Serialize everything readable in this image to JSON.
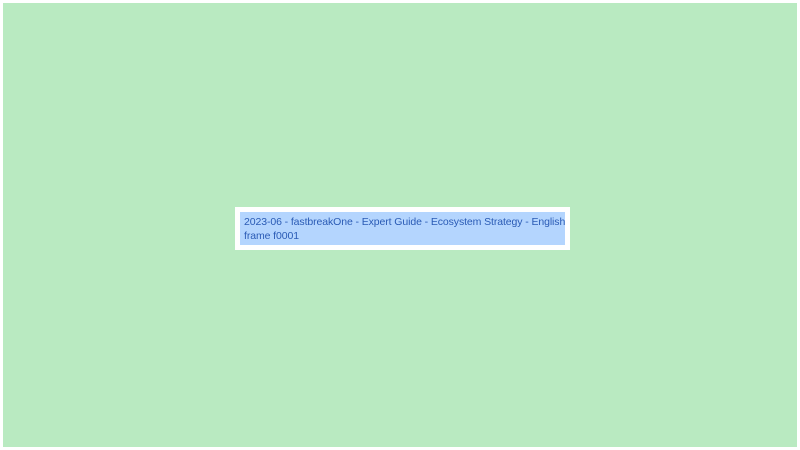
{
  "caption": {
    "line1": "2023-06 - fastbreakOne - Expert Guide - Ecosystem Strategy - English",
    "line2": "frame f0001"
  },
  "colors": {
    "background": "#b9eac1",
    "caption_box": "#ffffff",
    "highlight": "#b4d5fe",
    "text": "#2a5bb5"
  }
}
